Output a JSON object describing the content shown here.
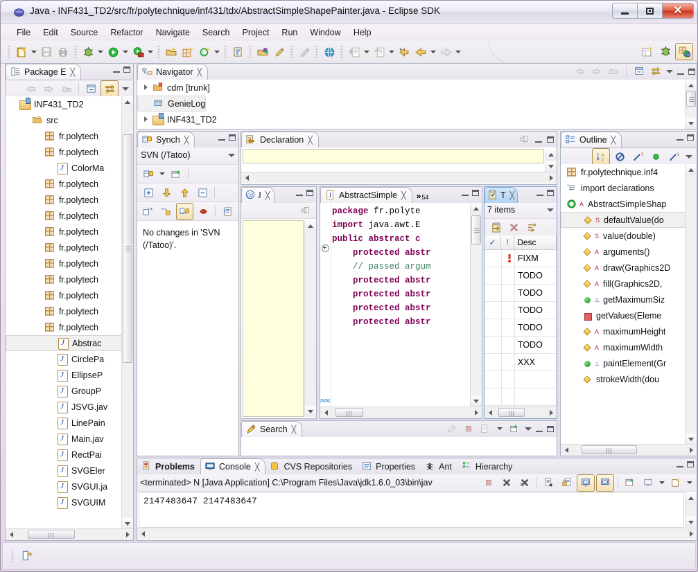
{
  "window": {
    "title": "Java - INF431_TD2/src/fr/polytechnique/inf431/tdx/AbstractSimpleShapePainter.java - Eclipse SDK",
    "app_icon": "eclipse-icon",
    "minimize": "–",
    "maximize": "□",
    "close": "✕"
  },
  "menubar": {
    "items": [
      "File",
      "Edit",
      "Source",
      "Refactor",
      "Navigate",
      "Search",
      "Project",
      "Run",
      "Window",
      "Help"
    ]
  },
  "toolbar": {
    "groups": [
      [
        "new-wizard-icon",
        "dropdown",
        "save-icon",
        "print-icon"
      ],
      [
        "debug-icon",
        "dropdown",
        "run-icon",
        "dropdown",
        "run-coverage-icon",
        "dropdown"
      ],
      [
        "open-type-icon",
        "new-package-icon",
        "new-class-icon",
        "dropdown"
      ],
      [
        "toggle-mark-occurrences-icon"
      ],
      [
        "open-task-icon",
        "new-annotation-icon"
      ],
      [
        "skip-breakpoints-icon"
      ],
      [
        "open-web-browser-icon"
      ],
      [
        "previous-annotation-icon",
        "dropdown",
        "next-annotation-icon",
        "dropdown",
        "back-history-icon",
        "back-icon",
        "dropdown",
        "forward-icon",
        "dropdown"
      ]
    ],
    "right_items": [
      "new-java-project-icon",
      "debug-perspective-icon",
      "java-perspective-icon"
    ]
  },
  "package_explorer": {
    "tab_label": "Package E",
    "tab_icon": "package-explorer-icon",
    "toolbar": [
      "back-icon",
      "forward-icon",
      "up-icon",
      "collapse-all-icon",
      "link-with-editor-icon",
      "view-menu-icon"
    ],
    "tree": [
      {
        "label": "INF431_TD2",
        "icon": "java-project-icon",
        "indent": 0,
        "twisty": false
      },
      {
        "label": "src",
        "icon": "source-folder-icon",
        "indent": 1,
        "twisty": false
      },
      {
        "label": "fr.polytech",
        "icon": "package-icon",
        "indent": 2,
        "twisty": false
      },
      {
        "label": "fr.polytech",
        "icon": "package-icon",
        "indent": 2,
        "twisty": false
      },
      {
        "label": "ColorMa",
        "icon": "java-file-icon",
        "indent": 3,
        "twisty": false
      },
      {
        "label": "fr.polytech",
        "icon": "package-icon",
        "indent": 2,
        "twisty": false
      },
      {
        "label": "fr.polytech",
        "icon": "package-icon",
        "indent": 2,
        "twisty": false
      },
      {
        "label": "fr.polytech",
        "icon": "package-icon",
        "indent": 2,
        "twisty": false
      },
      {
        "label": "fr.polytech",
        "icon": "package-icon",
        "indent": 2,
        "twisty": false
      },
      {
        "label": "fr.polytech",
        "icon": "package-icon",
        "indent": 2,
        "twisty": false
      },
      {
        "label": "fr.polytech",
        "icon": "package-icon",
        "indent": 2,
        "twisty": false
      },
      {
        "label": "fr.polytech",
        "icon": "package-icon",
        "indent": 2,
        "twisty": false
      },
      {
        "label": "fr.polytech",
        "icon": "package-icon",
        "indent": 2,
        "twisty": false
      },
      {
        "label": "fr.polytech",
        "icon": "package-icon",
        "indent": 2,
        "twisty": false
      },
      {
        "label": "fr.polytech",
        "icon": "package-icon",
        "indent": 2,
        "twisty": false
      },
      {
        "label": "Abstrac",
        "icon": "java-file-icon",
        "indent": 3,
        "twisty": false,
        "selected": true
      },
      {
        "label": "CirclePa",
        "icon": "java-file-icon",
        "indent": 3,
        "twisty": false
      },
      {
        "label": "EllipseP",
        "icon": "java-file-icon",
        "indent": 3,
        "twisty": false
      },
      {
        "label": "GroupP",
        "icon": "java-file-icon",
        "indent": 3,
        "twisty": false
      },
      {
        "label": "JSVG.jav",
        "icon": "java-file-icon",
        "indent": 3,
        "twisty": false
      },
      {
        "label": "LinePain",
        "icon": "java-file-icon",
        "indent": 3,
        "twisty": false
      },
      {
        "label": "Main.jav",
        "icon": "java-file-icon",
        "indent": 3,
        "twisty": false
      },
      {
        "label": "RectPai",
        "icon": "java-file-icon",
        "indent": 3,
        "twisty": false
      },
      {
        "label": "SVGEler",
        "icon": "java-file-icon",
        "indent": 3,
        "twisty": false
      },
      {
        "label": "SVGUI.ja",
        "icon": "java-file-icon",
        "indent": 3,
        "twisty": false
      },
      {
        "label": "SVGUIM",
        "icon": "java-file-icon",
        "indent": 3,
        "twisty": false
      }
    ]
  },
  "navigator": {
    "tab_label": "Navigator",
    "tab_icon": "navigator-icon",
    "toolbar": [
      "back-icon",
      "forward-icon",
      "up-icon",
      "collapse-all-icon",
      "link-with-editor-icon",
      "view-menu-icon"
    ],
    "tree": [
      {
        "label": "cdm [trunk]",
        "icon": "svn-project-icon",
        "twisty": true
      },
      {
        "label": "GenieLog",
        "icon": "folder-icon",
        "twisty": false,
        "selected": true
      },
      {
        "label": "INF431_TD2",
        "icon": "java-project-icon",
        "twisty": true
      }
    ]
  },
  "synchronize": {
    "tab_label": "Synch",
    "tab_icon": "synchronize-icon",
    "subtitle": "SVN (/Tatoo)",
    "toolbar_row1": [
      "synchronize-icon",
      "dropdown",
      "new-synchronization-icon"
    ],
    "toolbar_row2": [
      "expand-all-icon",
      "next-change-icon",
      "previous-change-icon",
      "collapse-all-icon"
    ],
    "toolbar_row3": [
      "outgoing-mode-icon",
      "incoming-mode-icon",
      "both-mode-icon",
      "conflicts-mode-icon",
      "compare-icon"
    ],
    "message": "No changes in 'SVN (/Tatoo)'."
  },
  "declaration": {
    "tab_label": "Declaration",
    "tab_icon": "declaration-icon",
    "toolbar": [
      "open-input-icon"
    ],
    "content": ""
  },
  "javadoc": {
    "tab_label": "J",
    "tab_icon": "javadoc-icon",
    "toolbar": [
      "open-input-icon"
    ],
    "content": ""
  },
  "editor": {
    "tab_label": "AbstractSimple",
    "tab_icon": "java-file-icon",
    "overflow_count": "54",
    "overflow_symbol": "»",
    "lines": [
      [
        {
          "t": "kw",
          "s": "package"
        },
        {
          "t": "pl",
          "s": " fr.polyte"
        }
      ],
      [
        {
          "t": "pl",
          "s": ""
        }
      ],
      [
        {
          "t": "kw",
          "s": "import"
        },
        {
          "t": "pl",
          "s": " java.awt.E"
        }
      ],
      [
        {
          "t": "pl",
          "s": ""
        }
      ],
      [
        {
          "t": "kw",
          "s": "public abstract c"
        }
      ],
      [
        {
          "t": "pl",
          "s": ""
        }
      ],
      [
        {
          "t": "kw",
          "s": "    protected abstr"
        }
      ],
      [
        {
          "t": "pl",
          "s": ""
        }
      ],
      [
        {
          "t": "cm",
          "s": "    // passed argum"
        }
      ],
      [
        {
          "t": "kw",
          "s": "    protected abstr"
        }
      ],
      [
        {
          "t": "kw",
          "s": "    protected abstr"
        }
      ],
      [
        {
          "t": "kw",
          "s": "    protected abstr"
        }
      ],
      [
        {
          "t": "kw",
          "s": "    protected abstr"
        }
      ]
    ]
  },
  "tasks": {
    "tab_label": "T",
    "tab_icon": "tasks-icon",
    "count_label": "7 items",
    "toolbar": [
      "add-task-icon",
      "delete-task-icon",
      "filters-icon"
    ],
    "columns": [
      "✓",
      "!",
      "Desc"
    ],
    "rows": [
      {
        "check": "",
        "priority": "high",
        "description": "FIXM"
      },
      {
        "check": "",
        "priority": "",
        "description": "TODO"
      },
      {
        "check": "",
        "priority": "",
        "description": "TODO"
      },
      {
        "check": "",
        "priority": "",
        "description": "TODO"
      },
      {
        "check": "",
        "priority": "",
        "description": "TODO"
      },
      {
        "check": "",
        "priority": "",
        "description": "TODO"
      },
      {
        "check": "",
        "priority": "",
        "description": "XXX"
      },
      {
        "check": "",
        "priority": "",
        "description": ""
      },
      {
        "check": "",
        "priority": "",
        "description": ""
      },
      {
        "check": "",
        "priority": "",
        "description": ""
      }
    ]
  },
  "search": {
    "tab_label": "Search",
    "tab_icon": "search-icon",
    "toolbar": [
      "cancel-search-icon",
      "stop-icon",
      "show-previous-search-icon",
      "dropdown",
      "pin-icon",
      "view-menu-icon"
    ],
    "content": ""
  },
  "outline": {
    "tab_label": "Outline",
    "tab_icon": "outline-icon",
    "toolbar": [
      "sort-icon",
      "hide-fields-icon",
      "hide-static-icon",
      "hide-nonpublic-icon",
      "hide-local-types-icon",
      "view-menu-icon"
    ],
    "items": [
      {
        "label": "fr.polytechnique.inf4",
        "icon": "package-icon",
        "modifier": "",
        "indent": 0
      },
      {
        "label": "import declarations",
        "icon": "import-icon",
        "modifier": "",
        "indent": 0
      },
      {
        "label": "AbstractSimpleShap",
        "icon": "class-icon",
        "modifier": "A",
        "indent": 0
      },
      {
        "label": "defaultValue(do",
        "icon": "field-icon",
        "modifier": "S",
        "indent": 1,
        "selected": true
      },
      {
        "label": "value(double)",
        "icon": "field-icon",
        "modifier": "S",
        "indent": 1
      },
      {
        "label": "arguments()",
        "icon": "field-icon",
        "modifier": "A",
        "indent": 1
      },
      {
        "label": "draw(Graphics2D",
        "icon": "field-icon",
        "modifier": "A",
        "indent": 1
      },
      {
        "label": "fill(Graphics2D, ",
        "icon": "field-icon",
        "modifier": "A",
        "indent": 1
      },
      {
        "label": "getMaximumSiz",
        "icon": "method-public-icon",
        "modifier": "△",
        "indent": 1
      },
      {
        "label": "getValues(Eleme",
        "icon": "method-private-icon",
        "modifier": "",
        "indent": 1
      },
      {
        "label": "maximumHeight",
        "icon": "field-icon",
        "modifier": "A",
        "indent": 1
      },
      {
        "label": "maximumWidth",
        "icon": "field-icon",
        "modifier": "A",
        "indent": 1
      },
      {
        "label": "paintElement(Gr",
        "icon": "method-public-icon",
        "modifier": "△",
        "indent": 1
      },
      {
        "label": "strokeWidth(dou",
        "icon": "field-icon",
        "modifier": "",
        "indent": 1
      }
    ]
  },
  "bottom_panel": {
    "tabs": [
      {
        "label": "Problems",
        "icon": "problems-icon",
        "active": false,
        "bold": true
      },
      {
        "label": "Console",
        "icon": "console-icon",
        "active": true,
        "bold": false
      },
      {
        "label": "CVS Repositories",
        "icon": "cvs-icon",
        "active": false,
        "bold": false
      },
      {
        "label": "Properties",
        "icon": "properties-icon",
        "active": false,
        "bold": false
      },
      {
        "label": "Ant",
        "icon": "ant-icon",
        "active": false,
        "bold": false
      },
      {
        "label": "Hierarchy",
        "icon": "hierarchy-icon",
        "active": false,
        "bold": false
      }
    ],
    "console_header": "<terminated> N [Java Application] C:\\Program Files\\Java\\jdk1.6.0_03\\bin\\jav",
    "console_toolbar": [
      "terminate-icon",
      "remove-launch-icon",
      "remove-all-terminated-icon",
      "clear-console-icon",
      "scroll-lock-icon",
      "pin-console-icon",
      "display-selected-console-icon",
      "open-console-icon",
      "new-console-view-icon",
      "dropdown",
      "view-menu-icon",
      "dropdown"
    ],
    "console_output": "2147483647  2147483647"
  },
  "statusbar": {
    "icon": "editor-insert-mode-icon",
    "text": ""
  },
  "colors": {
    "accent_blue": "#b2d3f3",
    "keyword": "#7f0055",
    "comment": "#3f7f5f",
    "yellow_field": "#ffffdd",
    "close_red": "#c8341c"
  }
}
